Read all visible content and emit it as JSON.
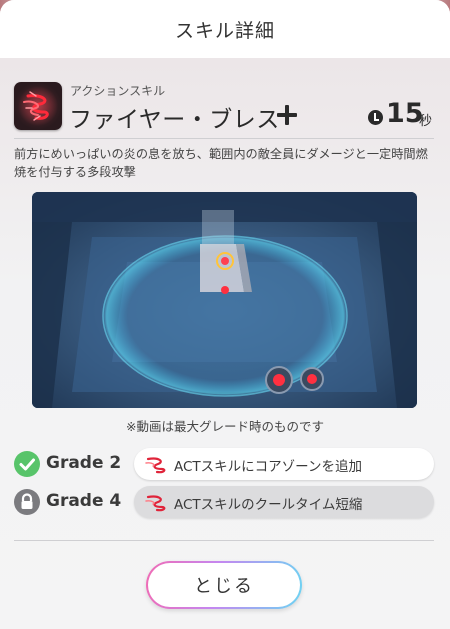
{
  "dialog": {
    "title": "スキル詳細",
    "close_label": "とじる"
  },
  "skill": {
    "type_label": "アクションスキル",
    "name": "ファイヤー・ブレス",
    "cooldown_value": "15",
    "cooldown_unit": "秒",
    "description": "前方にめいっぱいの炎の息を放ち、範囲内の敵全員にダメージと一定時間燃焼を付与する多段攻撃",
    "icon": "flame-spiral-icon"
  },
  "video": {
    "note": "※動画は最大グレード時のものです"
  },
  "grades": [
    {
      "label": "Grade 2",
      "status": "unlocked",
      "status_icon": "check-icon",
      "effect_icon": "flame-spiral-icon",
      "text": "ACTスキルにコアゾーンを追加"
    },
    {
      "label": "Grade 4",
      "status": "locked",
      "status_icon": "lock-icon",
      "effect_icon": "flame-spiral-icon",
      "text": "ACTスキルのクールタイム短縮"
    }
  ],
  "colors": {
    "unlocked_badge": "#58c46a",
    "locked_badge": "#7b7b7f",
    "accent_red": "#e0243a",
    "button_gradient": [
      "#f06bb4",
      "#c487f0",
      "#6dd4f2"
    ]
  }
}
